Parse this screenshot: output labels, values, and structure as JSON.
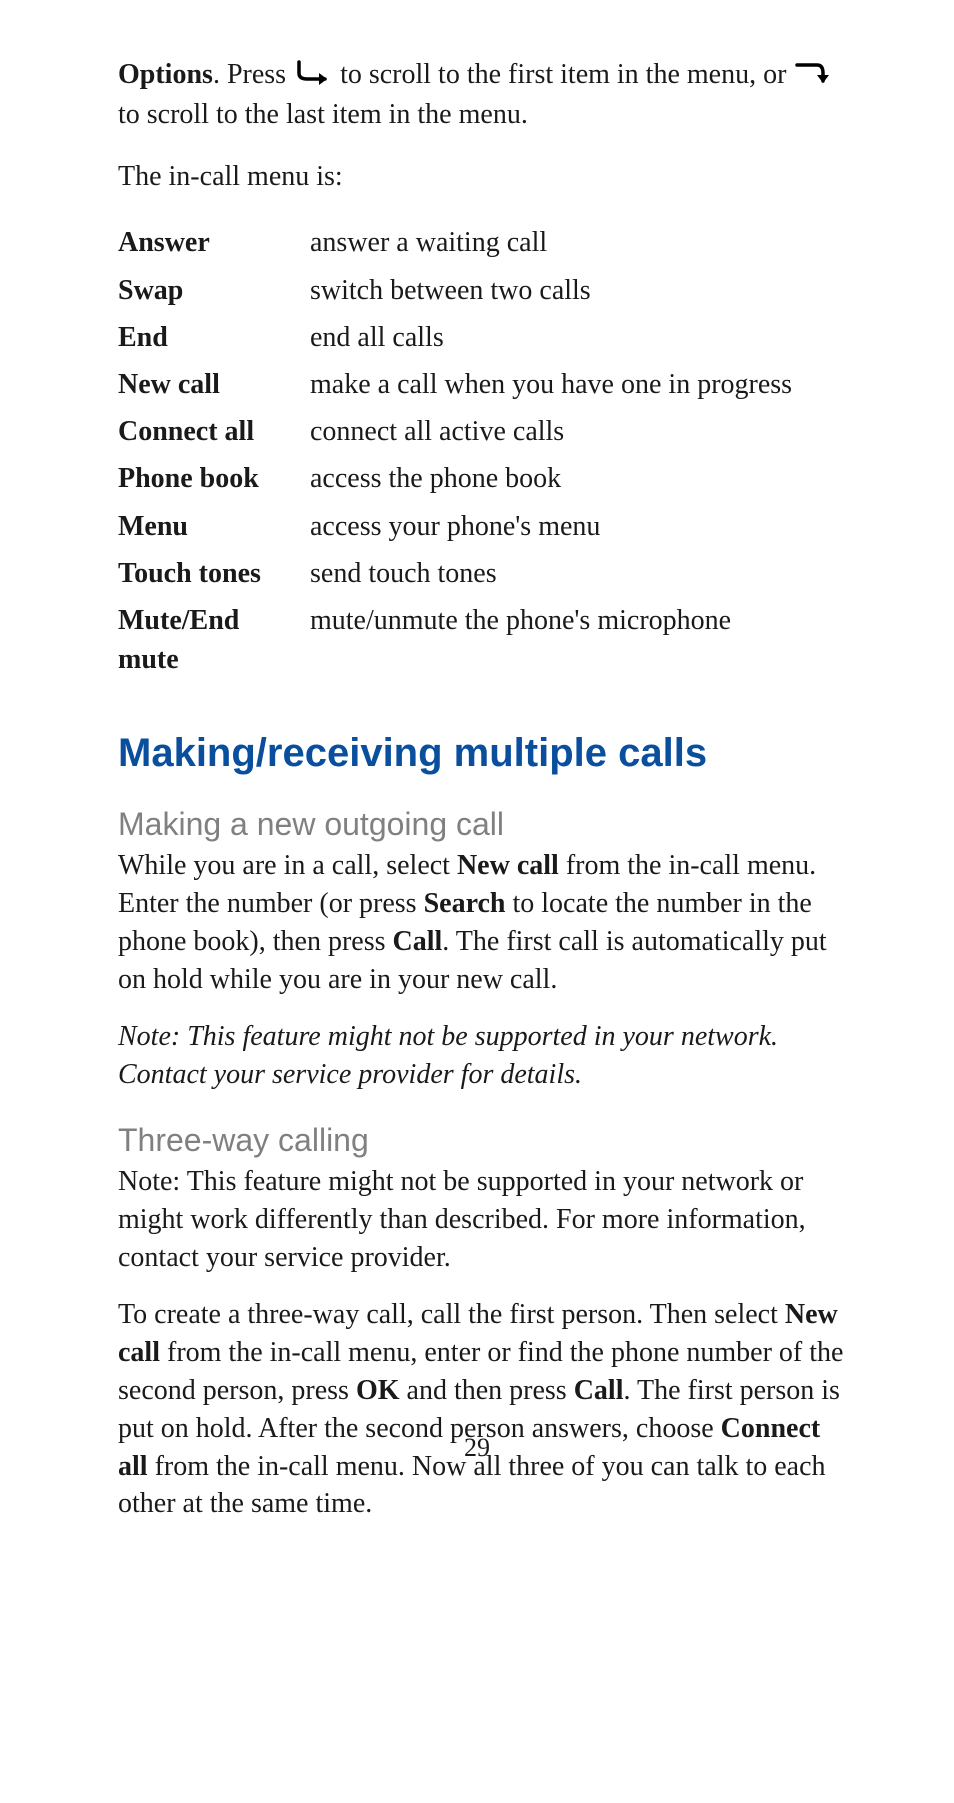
{
  "intro": {
    "options_word": "Options",
    "after_options": ". Press ",
    "mid1": " to scroll to the first item in the menu, or ",
    "mid2": " to scroll to the last item in the menu."
  },
  "subintro": "The in-call menu is:",
  "menu_items": [
    {
      "term": "Answer",
      "desc": "answer a waiting call"
    },
    {
      "term": "Swap",
      "desc": "switch between two calls"
    },
    {
      "term": "End",
      "desc": "end all calls"
    },
    {
      "term": "New call",
      "desc": "make a call when you have one in progress"
    },
    {
      "term": "Connect all",
      "desc": "connect all active calls"
    },
    {
      "term": "Phone book",
      "desc": "access the phone book"
    },
    {
      "term": "Menu",
      "desc": "access your phone's menu"
    },
    {
      "term": "Touch tones",
      "desc": "send touch tones"
    },
    {
      "term": "Mute/End mute",
      "desc": "mute/unmute the phone's microphone"
    }
  ],
  "section_heading": "Making/receiving multiple calls",
  "sub1_heading": "Making a new outgoing call",
  "sub1_para": {
    "t1": "While you are in a call, select ",
    "b1": "New call",
    "t2": " from the in-call menu. Enter the number (or press ",
    "b2": "Search",
    "t3": " to locate the number in the phone book), then press ",
    "b3": "Call",
    "t4": ". The first call is automatically put on hold while you are in your new call."
  },
  "sub1_note": "Note:  This feature might not be supported in your network. Contact your service provider for details.",
  "sub2_heading": "Three-way calling",
  "sub2_para1": "Note:  This feature might not be supported in your network or might work differently than described. For more information, contact your service provider.",
  "sub2_para2": {
    "t1": "To create a three-way call, call the first person. Then select ",
    "b1": "New call",
    "t2": " from the in-call menu, enter or find the phone number of the second person, press ",
    "b2": "OK",
    "t3": " and then press ",
    "b3": "Call",
    "t4": ". The first person is put on hold. After the second person answers, choose ",
    "b4": "Connect all",
    "t5": " from the in-call menu. Now all three of you can talk to each other at the same time."
  },
  "page_number": "29"
}
